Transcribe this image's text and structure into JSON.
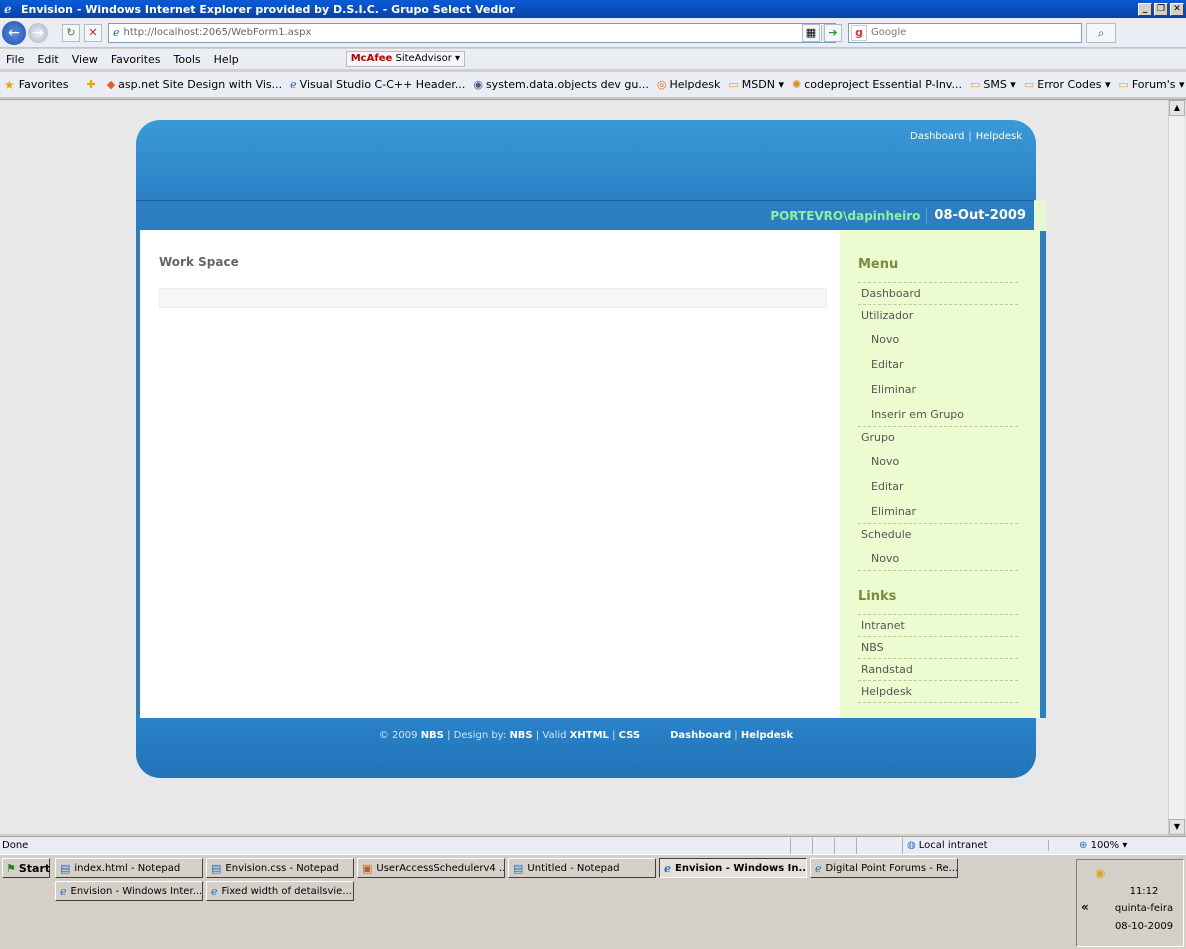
{
  "window": {
    "title": "Envision - Windows Internet Explorer provided by D.S.I.C. - Grupo Select Vedior",
    "buttons": [
      "_",
      "❐",
      "✕"
    ]
  },
  "address": {
    "url": "http://localhost:2065/WebForm1.aspx",
    "search_placeholder": "Google"
  },
  "menubar": {
    "items": [
      "File",
      "Edit",
      "View",
      "Favorites",
      "Tools",
      "Help"
    ],
    "mcafee_brand": "McAfee",
    "mcafee_label": "SiteAdvisor ▾"
  },
  "favorites": {
    "label": "Favorites",
    "items": [
      "asp.net Site Design with Vis...",
      "Visual Studio C-C++ Header...",
      "system.data.objects dev gu...",
      "Helpdesk",
      "MSDN ▾",
      "codeproject Essential P-Inv...",
      "SMS ▾",
      "Error Codes ▾",
      "Forum's ▾"
    ]
  },
  "site": {
    "header_links": [
      "Dashboard",
      "Helpdesk"
    ],
    "user": "PORTEVRO\\dapinheiro",
    "date": "08-Out-2009",
    "workspace_title": "Work Space",
    "menu_heading": "Menu",
    "menu": [
      {
        "label": "Dashboard",
        "sub": false
      },
      {
        "label": "Utilizador",
        "sub": false
      },
      {
        "label": "Novo",
        "sub": true
      },
      {
        "label": "Editar",
        "sub": true
      },
      {
        "label": "Eliminar",
        "sub": true
      },
      {
        "label": "Inserir em Grupo",
        "sub": true
      },
      {
        "label": "Grupo",
        "sub": false
      },
      {
        "label": "Novo",
        "sub": true
      },
      {
        "label": "Editar",
        "sub": true
      },
      {
        "label": "Eliminar",
        "sub": true
      },
      {
        "label": "Schedule",
        "sub": false
      },
      {
        "label": "Novo",
        "sub": true
      }
    ],
    "links_heading": "Links",
    "links": [
      "Intranet",
      "NBS",
      "Randstad",
      "Helpdesk"
    ],
    "footer": {
      "copyright": "© 2009",
      "nbs1": "NBS",
      "design_by": "| Design by:",
      "nbs2": "NBS",
      "valid": "| Valid",
      "xhtml": "XHTML",
      "css": "CSS",
      "dashboard": "Dashboard",
      "helpdesk": "Helpdesk"
    }
  },
  "status": {
    "text": "Done",
    "zone": "Local intranet",
    "zoom": "100%"
  },
  "taskbar": {
    "start": "Start",
    "tasks_row1": [
      "index.html - Notepad",
      "Envision.css - Notepad",
      "UserAccessSchedulerv4 ...",
      "Untitled - Notepad",
      "Envision - Windows In...",
      "Digital Point Forums - Re..."
    ],
    "tasks_row2": [
      "Envision - Windows Inter...",
      "Fixed width of detailsvie..."
    ],
    "time": "11:12",
    "day": "quinta-feira",
    "date": "08-10-2009"
  }
}
